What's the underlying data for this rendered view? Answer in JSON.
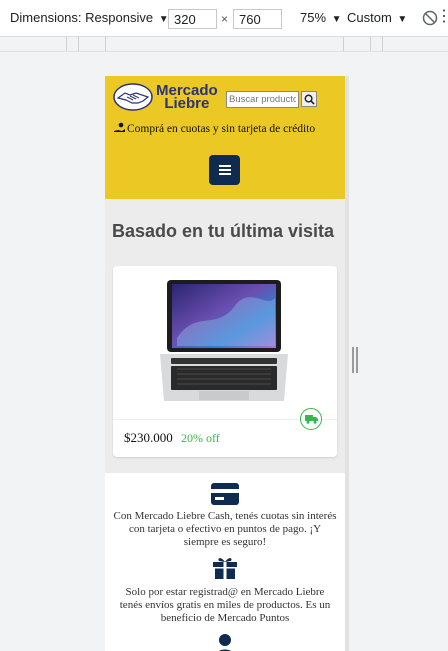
{
  "devtools": {
    "dimensions_label": "Dimensions: Responsive",
    "width": "320",
    "height": "760",
    "times": "×",
    "zoom": "75%",
    "throttle": "Custom"
  },
  "header": {
    "brand_line1": "Mercado",
    "brand_line2": "Liebre",
    "search_placeholder": "Buscar productos",
    "promo_text": "Comprá en cuotas y sin tarjeta de crédito",
    "menu_icon": "hamburger-icon",
    "colors": {
      "header_bg": "#ebc824",
      "brand": "#2d3277",
      "menu_bg": "#0f2b50"
    }
  },
  "main": {
    "section_title": "Basado en tu última visita",
    "product": {
      "image": "laptop-image",
      "price": "$230.000",
      "discount": "20% off",
      "shipping_icon": "truck-icon",
      "discount_color": "#39b54a"
    }
  },
  "benefits": [
    {
      "icon": "credit-card-icon",
      "text": "Con Mercado Liebre Cash, tenés cuotas sin interés con tarjeta o efectivo en puntos de pago. ¡Y siempre es seguro!"
    },
    {
      "icon": "gift-icon",
      "text": "Solo por estar registrad@ en Mercado Liebre tenés envíos gratis en miles de productos. Es un beneficio de Mercado Puntos"
    }
  ]
}
